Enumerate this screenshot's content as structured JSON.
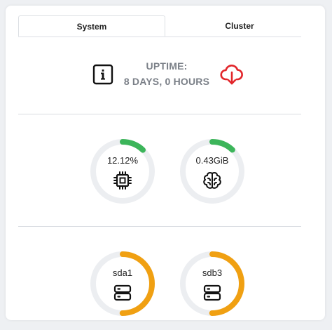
{
  "tabs": [
    {
      "label": "System",
      "active": true
    },
    {
      "label": "Cluster",
      "active": false
    }
  ],
  "uptime": {
    "label": "UPTIME:",
    "value": "8 DAYS, 0 HOURS"
  },
  "colors": {
    "ring_track": "#eceef1",
    "ring_low": "#3cb55a",
    "ring_high": "#f0a012",
    "cloud_icon": "#e2262b"
  },
  "gauges": [
    {
      "id": "cpu",
      "value": "12.12%",
      "fraction": 0.1212,
      "icon": "cpu-chip-icon"
    },
    {
      "id": "memory",
      "value": "0.43GiB",
      "fraction": 0.12,
      "icon": "brain-icon"
    },
    {
      "id": "sda1",
      "value": "sda1",
      "fraction": 0.5,
      "icon": "storage-drive-icon"
    },
    {
      "id": "sdb3",
      "value": "sdb3",
      "fraction": 0.5,
      "icon": "storage-drive-icon"
    }
  ]
}
